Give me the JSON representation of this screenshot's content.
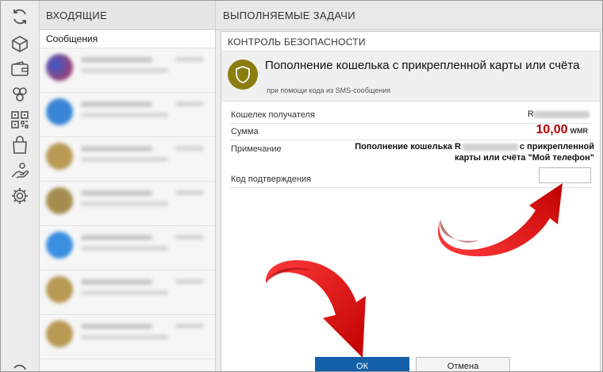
{
  "inbox": {
    "header": "ВХОДЯЩИЕ",
    "subheader": "Сообщения",
    "items": [
      {
        "avatar_color": "#6a4aa8"
      },
      {
        "avatar_color": "#3a86d6"
      },
      {
        "avatar_color": "#b89a55"
      },
      {
        "avatar_color": "#a58d50"
      },
      {
        "avatar_color": "#3b8fe0"
      },
      {
        "avatar_color": "#b89a55"
      },
      {
        "avatar_color": "#b89a55"
      }
    ]
  },
  "rail": {
    "icons": [
      "sync-icon",
      "box-icon",
      "wallet-icon",
      "people-icon",
      "qr-code-icon",
      "bag-icon",
      "hand-icon",
      "gear-icon"
    ]
  },
  "tasks": {
    "header": "ВЫПОЛНЯЕМЫЕ ЗАДАЧИ"
  },
  "dialog": {
    "title": "КОНТРОЛЬ БЕЗОПАСНОСТИ",
    "heading": "Пополнение кошелька с прикрепленной карты или счёта",
    "subheading": "при помощи кода из SMS-сообщения",
    "fields": {
      "recipient_label": "Кошелек получателя",
      "recipient_value_prefix": "R",
      "amount_label": "Сумма",
      "amount_value": "10,00",
      "amount_currency": "WMR",
      "note_label": "Примечание",
      "note_value_start": "Пополнение кошелька R",
      "note_value_end": "с прикрепленной карты или счёта \"Мой телефон\"",
      "code_label": "Код подтверждения",
      "code_value": ""
    },
    "ok_label": "ОК",
    "cancel_label": "Отмена"
  },
  "colors": {
    "accent": "#1460a8",
    "amount": "#b30000",
    "shield": "#8b7d0f",
    "arrow": "#e00000"
  }
}
